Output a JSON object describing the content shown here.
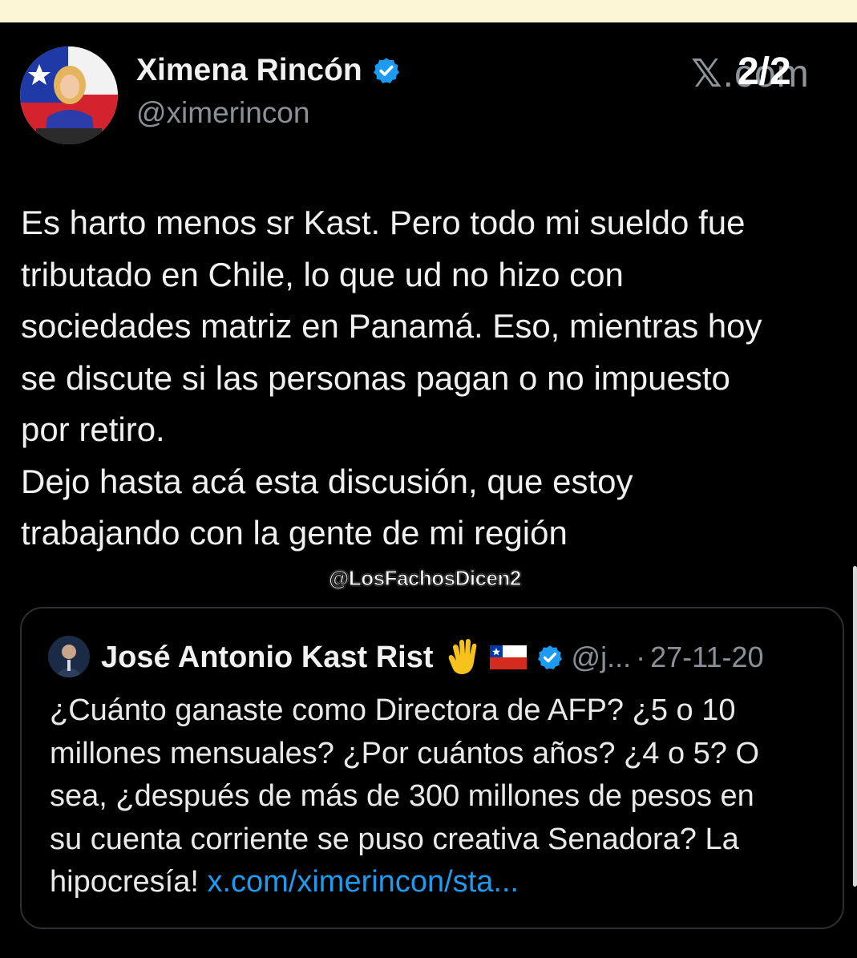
{
  "main_tweet": {
    "author_name": "Ximena Rincón",
    "author_handle": "@ximerincon",
    "text_lines": [
      "Es harto menos sr Kast. Pero todo mi  sueldo fue",
      "tributado en Chile, lo que ud no hizo con",
      "sociedades matriz en Panamá. Eso, mientras hoy",
      "se discute si las personas pagan o no impuesto",
      "por retiro.",
      "Dejo hasta acá esta discusión, que estoy",
      "trabajando con la gente de mi región"
    ]
  },
  "watermark": {
    "x_logo": "𝕏",
    "x_suffix": ".com",
    "page_counter": "2/2",
    "credit": "@LosFachosDicen2"
  },
  "quoted_tweet": {
    "author_name": "José Antonio Kast Rist",
    "emoji_icons": [
      "raised-hand-icon",
      "chile-flag-icon"
    ],
    "handle": "@j...",
    "separator": "·",
    "date": "27-11-20",
    "text_lines": [
      "¿Cuánto ganaste como Directora de AFP? ¿5 o 10",
      "millones mensuales? ¿Por cuántos años? ¿4 o 5? O",
      "sea, ¿después de más de 300 millones de pesos en",
      "su cuenta corriente se puso creativa Senadora? La"
    ],
    "last_line_text": "hipocresía! ",
    "link": "x.com/ximerincon/sta..."
  },
  "colors": {
    "background": "#000000",
    "top_strip": "#fcf6d6",
    "verified_badge": "#1d9bf0",
    "link": "#1d9bf0",
    "muted_text": "#8b9096"
  }
}
